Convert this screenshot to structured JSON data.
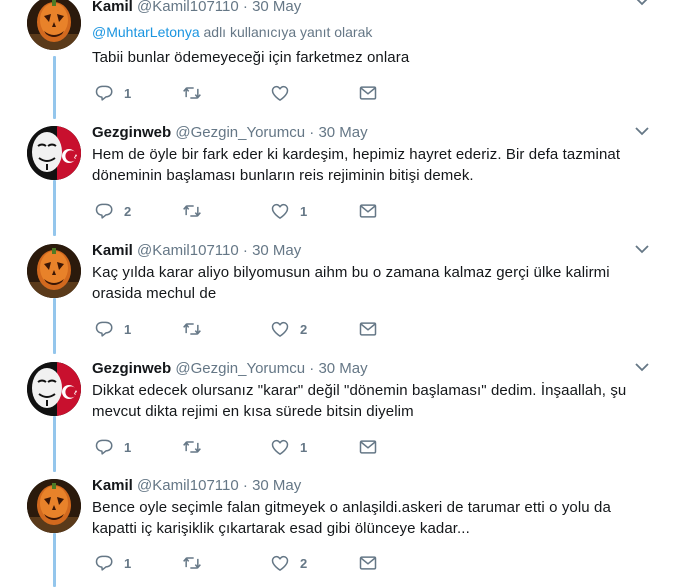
{
  "tweets": [
    {
      "name": "Kamil",
      "handle": "@Kamil107110",
      "separator": "·",
      "time": "30 May",
      "reply_context": {
        "mention": "@MuhtarLetonya",
        "suffix": "adlı kullanıcıya yanıt olarak"
      },
      "text": "Tabii bunlar ödemeyeceği için farketmez onlara",
      "replies": "1",
      "retweets": "",
      "likes": "",
      "avatar": "pumpkin-avatar"
    },
    {
      "name": "Gezginweb",
      "handle": "@Gezgin_Yorumcu",
      "separator": "·",
      "time": "30 May",
      "text": "Hem de öyle bir fark eder ki kardeşim, hepimiz hayret ederiz. Bir defa tazminat döneminin başlaması bunların reis rejiminin bitişi demek.",
      "replies": "2",
      "retweets": "",
      "likes": "1",
      "avatar": "mask-flag-avatar"
    },
    {
      "name": "Kamil",
      "handle": "@Kamil107110",
      "separator": "·",
      "time": "30 May",
      "text": "Kaç yılda karar aliyo bilyomusun aihm bu o zamana kalmaz gerçi ülke kalirmi orasida mechul de",
      "replies": "1",
      "retweets": "",
      "likes": "2",
      "avatar": "pumpkin-avatar"
    },
    {
      "name": "Gezginweb",
      "handle": "@Gezgin_Yorumcu",
      "separator": "·",
      "time": "30 May",
      "text": "Dikkat edecek olursanız \"karar\" değil \"dönemin başlaması\" dedim. İnşaallah, şu mevcut dikta rejimi en kısa sürede bitsin diyelim",
      "replies": "1",
      "retweets": "",
      "likes": "1",
      "avatar": "mask-flag-avatar"
    },
    {
      "name": "Kamil",
      "handle": "@Kamil107110",
      "separator": "·",
      "time": "30 May",
      "text": "Bence oyle seçimle falan gitmeyek o anlaşildi.askeri de tarumar etti o yolu da kapatti iç karişiklik çıkartarak esad gibi ölünceye kadar...",
      "replies": "1",
      "retweets": "",
      "likes": "2",
      "avatar": "pumpkin-avatar"
    }
  ],
  "colors": {
    "accent": "#1b95e0",
    "thread": "#94c6ec",
    "muted": "#657786",
    "text": "#14171a"
  }
}
